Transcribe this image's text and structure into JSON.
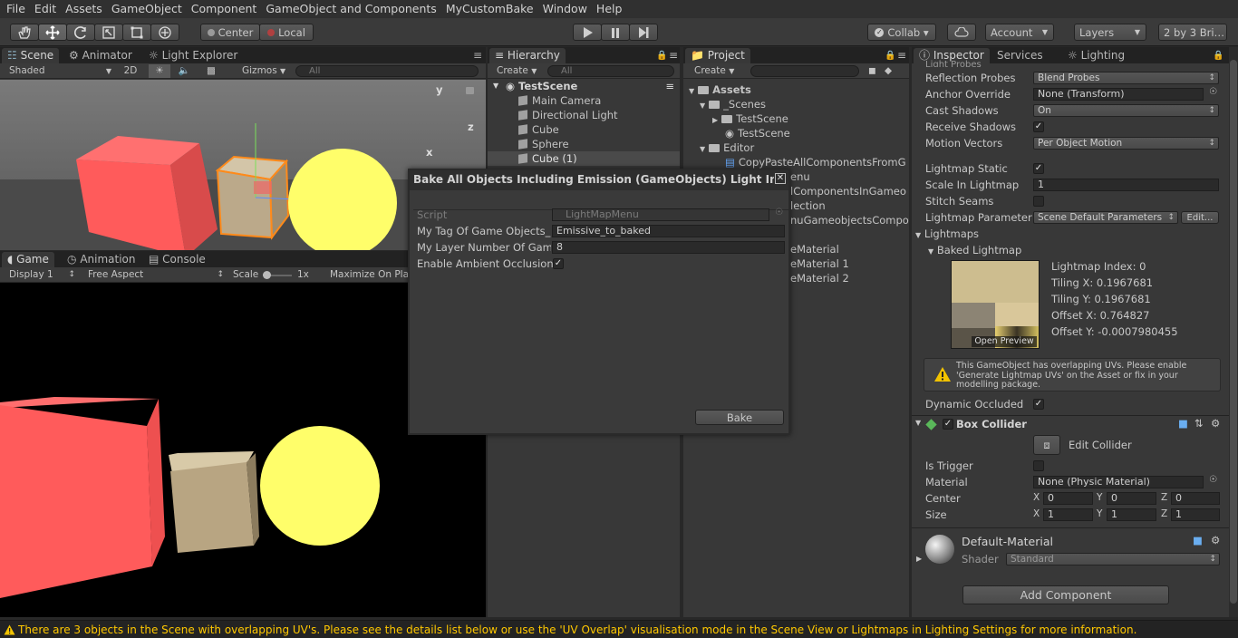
{
  "menu": [
    "File",
    "Edit",
    "Assets",
    "GameObject",
    "Component",
    "GameObject and Components",
    "MyCustomBake",
    "Window",
    "Help"
  ],
  "toolbar": {
    "pivot_center": "Center",
    "pivot_local": "Local",
    "collab": "Collab ▾",
    "account": "Account",
    "layers": "Layers",
    "layout": "2 by 3 Bri…"
  },
  "scene": {
    "tabs": [
      "Scene",
      "Animator",
      "Light Explorer"
    ],
    "shading": "Shaded",
    "mode_2d": "2D",
    "gizmos": "Gizmos",
    "search": "All",
    "axis_y": "y",
    "axis_z": "z",
    "axis_x": "x",
    "colors": {
      "red_cube": "#ff5a5a",
      "yellow_sphere": "#fffe6a",
      "sky": "#6d6d6d",
      "ground": "#464646"
    }
  },
  "game": {
    "tabs": [
      "Game",
      "Animation",
      "Console"
    ],
    "display": "Display 1",
    "aspect": "Free Aspect",
    "scale_label": "Scale",
    "scale_value": "1x",
    "maximize": "Maximize On Pla"
  },
  "hierarchy": {
    "tab": "Hierarchy",
    "create": "Create",
    "search": "All",
    "scene_name": "TestScene",
    "items": [
      "Main Camera",
      "Directional Light",
      "Cube",
      "Sphere",
      "Cube (1)"
    ]
  },
  "project": {
    "tab": "Project",
    "create": "Create",
    "root": "Assets",
    "scenes_folder": "_Scenes",
    "scene_folder": "TestScene",
    "scene_asset": "TestScene",
    "editor_folder": "Editor",
    "editor_script": "CopyPasteAllComponentsFromG",
    "clipped": [
      "enu",
      "lComponentsInGameo",
      "lection",
      "nuGameobjectsCompo",
      "eMaterial",
      "eMaterial 1",
      "eMaterial 2"
    ]
  },
  "dialog": {
    "title": "Bake All Objects Including Emission (GameObjects) Light Into L…",
    "script_label": "Script",
    "script_value": "LightMapMenu",
    "tag_label": "My Tag Of Game Objects_",
    "tag_value": "Emissive_to_baked",
    "layer_label": "My Layer Number Of Gam",
    "layer_value": "8",
    "ao_label": "Enable Ambient Occlusion",
    "bake_button": "Bake"
  },
  "inspector": {
    "tabs": [
      "Inspector",
      "Services",
      "Lighting"
    ],
    "top_clip": "Light Probes",
    "reflection_label": "Reflection Probes",
    "reflection_value": "Blend Probes",
    "anchor_label": "Anchor Override",
    "anchor_value": "None (Transform)",
    "cast_label": "Cast Shadows",
    "cast_value": "On",
    "receive_label": "Receive Shadows",
    "motion_label": "Motion Vectors",
    "motion_value": "Per Object Motion",
    "lm_static_label": "Lightmap Static",
    "scale_lm_label": "Scale In Lightmap",
    "scale_lm_value": "1",
    "stitch_label": "Stitch Seams",
    "lm_param_label": "Lightmap Parameter",
    "lm_param_value": "Scene Default Parameters",
    "edit_btn": "Edit...",
    "lightmaps": "Lightmaps",
    "baked": "Baked Lightmap",
    "lm_index": "Lightmap Index: 0",
    "tiling_x": "Tiling X: 0.1967681",
    "tiling_y": "Tiling Y: 0.1967681",
    "offset_x": "Offset X: 0.764827",
    "offset_y": "Offset Y: -0.0007980455",
    "open_preview": "Open Preview",
    "warning": "This GameObject has overlapping UVs. Please enable 'Generate Lightmap UVs' on the Asset or fix in your modelling package.",
    "dyn_occ_label": "Dynamic Occluded",
    "box_collider": "Box Collider",
    "edit_collider": "Edit Collider",
    "trigger_label": "Is Trigger",
    "material_label": "Material",
    "material_value": "None (Physic Material)",
    "center_label": "Center",
    "center": {
      "x": "0",
      "y": "0",
      "z": "0"
    },
    "size_label": "Size",
    "size": {
      "x": "1",
      "y": "1",
      "z": "1"
    },
    "axis_x": "X",
    "axis_y": "Y",
    "axis_z": "Z",
    "mat_name": "Default-Material",
    "shader_label": "Shader",
    "shader_value": "Standard",
    "add_component": "Add Component"
  },
  "status": {
    "text": "There are 3 objects in the Scene with overlapping UV's. Please see the details list below or use the 'UV Overlap' visualisation mode in the Scene View or Lightmaps in Lighting Settings for more information.",
    "color": "#ffc800"
  }
}
